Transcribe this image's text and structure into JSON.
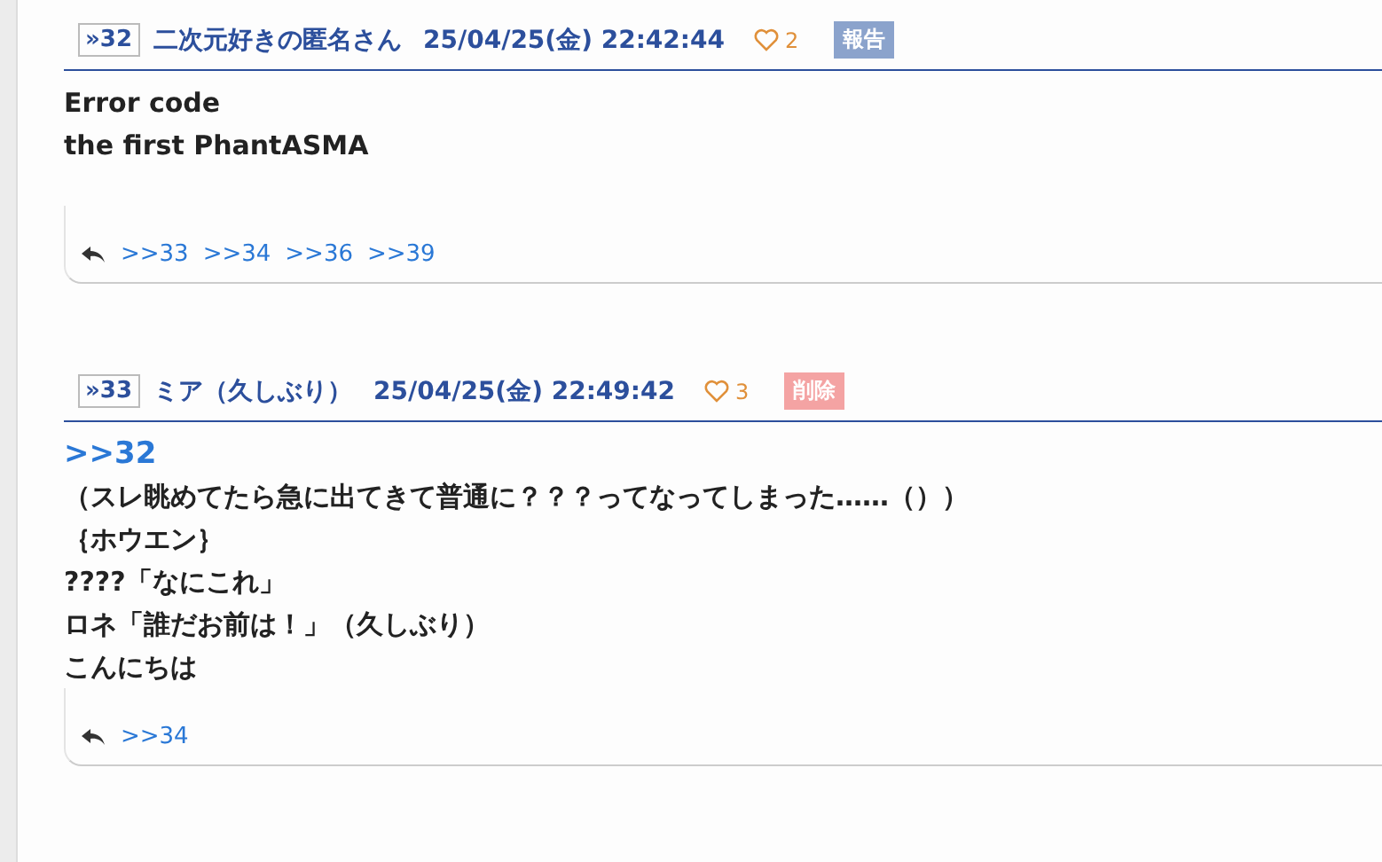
{
  "posts": [
    {
      "number": "»32",
      "name": "二次元好きの匿名さん",
      "date": "25/04/25(金) 22:42:44",
      "likes": "2",
      "action": {
        "kind": "report",
        "label": "報告"
      },
      "body": [
        {
          "kind": "text",
          "text": "Error code"
        },
        {
          "kind": "text",
          "text": "the first PhantASMA"
        }
      ],
      "replies": [
        ">>33",
        ">>34",
        ">>36",
        ">>39"
      ]
    },
    {
      "number": "»33",
      "name": "ミア（久しぶり）",
      "date": "25/04/25(金) 22:49:42",
      "likes": "3",
      "action": {
        "kind": "delete",
        "label": "削除"
      },
      "body": [
        {
          "kind": "anchor",
          "text": ">>32"
        },
        {
          "kind": "text",
          "text": "（スレ眺めてたら急に出てきて普通に？？？ってなってしまった……（））"
        },
        {
          "kind": "text",
          "text": "｛ホウエン｝"
        },
        {
          "kind": "text",
          "text": "????「なにこれ」"
        },
        {
          "kind": "text",
          "text": "ロネ「誰だお前は！」（久しぶり）"
        },
        {
          "kind": "text",
          "text": "こんにちは"
        }
      ],
      "replies": [
        ">>34"
      ]
    }
  ]
}
